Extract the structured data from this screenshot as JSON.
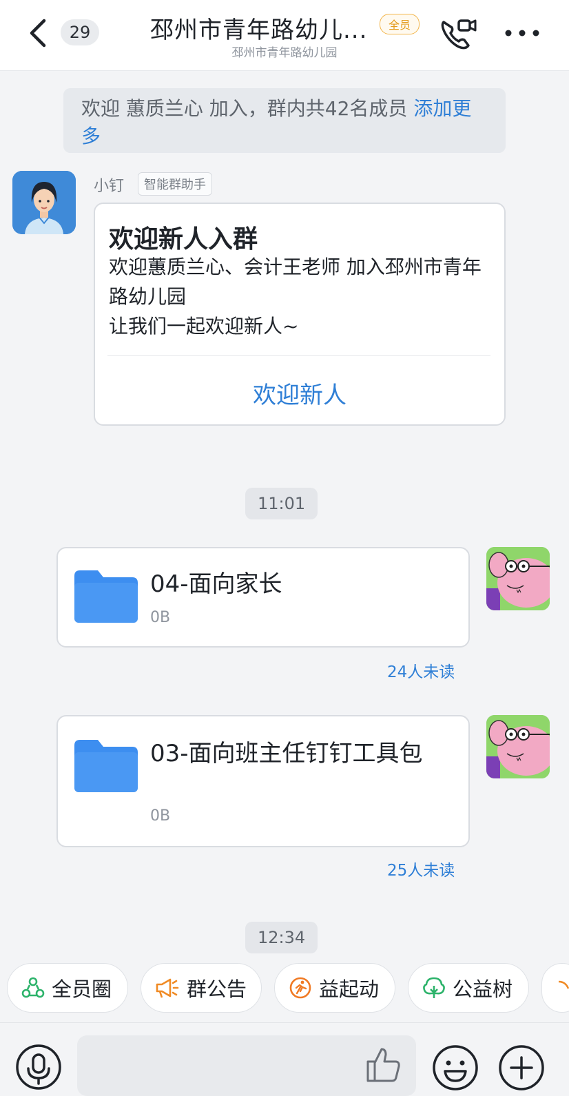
{
  "header": {
    "unread_count": "29",
    "title": "邳州市青年路幼儿...",
    "badge": "全员",
    "subtitle": "邳州市青年路幼儿园"
  },
  "notice": {
    "text": "欢迎 蕙质兰心 加入，群内共42名成员 ",
    "link": "添加更多"
  },
  "assistant": {
    "name": "小钉",
    "tag": "智能群助手",
    "card_title": "欢迎新人入群",
    "card_line1": "欢迎蕙质兰心、会计王老师 加入邳州市青年路幼儿园",
    "card_line2": "让我们一起欢迎新人~",
    "card_action": "欢迎新人"
  },
  "messages": [
    {
      "time": "11:01",
      "file_name": "04-面向家长",
      "file_size": "0B",
      "read_status": "24人未读"
    },
    {
      "file_name": "03-面向班主任钉钉工具包",
      "file_size": "0B",
      "read_status": "25人未读"
    }
  ],
  "last_time": "12:34",
  "quick_actions": [
    {
      "label": "全员圈",
      "icon": "circle-people-icon",
      "color": "#2db36b"
    },
    {
      "label": "群公告",
      "icon": "megaphone-icon",
      "color": "#f08a24"
    },
    {
      "label": "益起动",
      "icon": "run-icon",
      "color": "#f07a24"
    },
    {
      "label": "公益树",
      "icon": "tree-icon",
      "color": "#2db36b"
    }
  ],
  "input": {
    "placeholder": ""
  },
  "colors": {
    "accent": "#2f7fd6",
    "folder": "#3d8ef0",
    "badge": "#e39a1b"
  }
}
